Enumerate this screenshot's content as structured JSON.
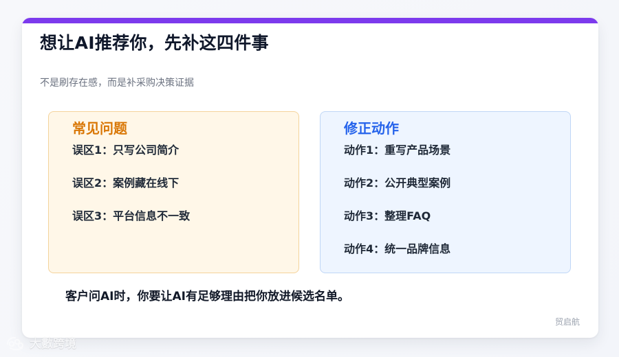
{
  "card": {
    "title": "想让AI推荐你，先补这四件事",
    "subtitle": "不是刷存在感，而是补采购决策证据",
    "left_panel": {
      "title": "常见问题",
      "items": [
        "误区1：只写公司简介",
        "误区2：案例藏在线下",
        "误区3：平台信息不一致"
      ]
    },
    "right_panel": {
      "title": "修正动作",
      "items": [
        "动作1：重写产品场景",
        "动作2：公开典型案例",
        "动作3：整理FAQ",
        "动作4：统一品牌信息"
      ]
    },
    "bottom_note": "客户问AI时，你要让AI有足够理由把你放进候选名单。",
    "signature": "贸启航"
  },
  "watermark": {
    "text": "大數跨境",
    "icon": "brand-logo-icon"
  },
  "colors": {
    "accent": "#7c3aed",
    "left_title": "#d97706",
    "right_title": "#2563eb",
    "left_panel_bg": "#fff7e8",
    "right_panel_bg": "#eef5ff"
  }
}
